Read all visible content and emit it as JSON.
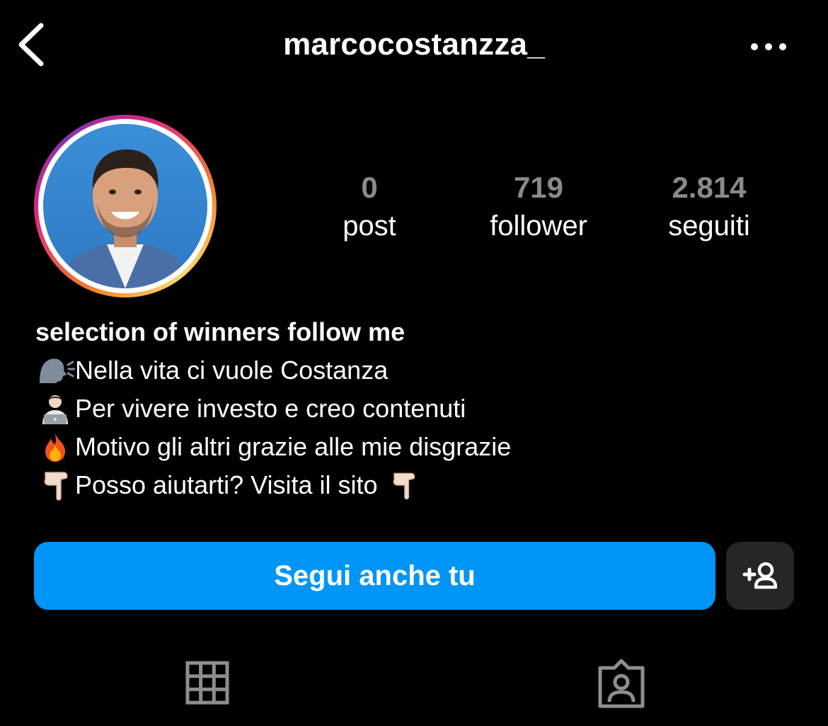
{
  "header": {
    "username": "marcocostanzza_",
    "back_icon": "chevron-left-icon",
    "more_icon": "ellipsis-icon"
  },
  "profile": {
    "avatar_icon": "profile-photo",
    "stats": [
      {
        "value": "0",
        "label": "post"
      },
      {
        "value": "719",
        "label": "follower"
      },
      {
        "value": "2.814",
        "label": "seguiti"
      }
    ]
  },
  "bio": {
    "name": "selection of winners follow me",
    "lines": [
      {
        "emoji": "🗣",
        "text": "Nella vita ci vuole Costanza"
      },
      {
        "emoji": "👨🏻‍💻",
        "text": "Per vivere investo e creo contenuti"
      },
      {
        "emoji": "🔥",
        "text": "Motivo gli altri grazie alle mie disgrazie"
      },
      {
        "emoji": "👇🏻",
        "text": "Posso aiutarti? Visita il sito",
        "trailing_emoji": "👇🏻"
      }
    ]
  },
  "actions": {
    "follow_label": "Segui anche tu",
    "suggest_icon": "add-user-icon"
  },
  "tabs": [
    {
      "icon": "grid-icon",
      "selected": true
    },
    {
      "icon": "tagged-user-icon",
      "selected": false
    }
  ],
  "colors": {
    "background": "#000000",
    "accent": "#0095f6",
    "secondary_button": "#262626",
    "stat_number": "#8a8a8a"
  }
}
